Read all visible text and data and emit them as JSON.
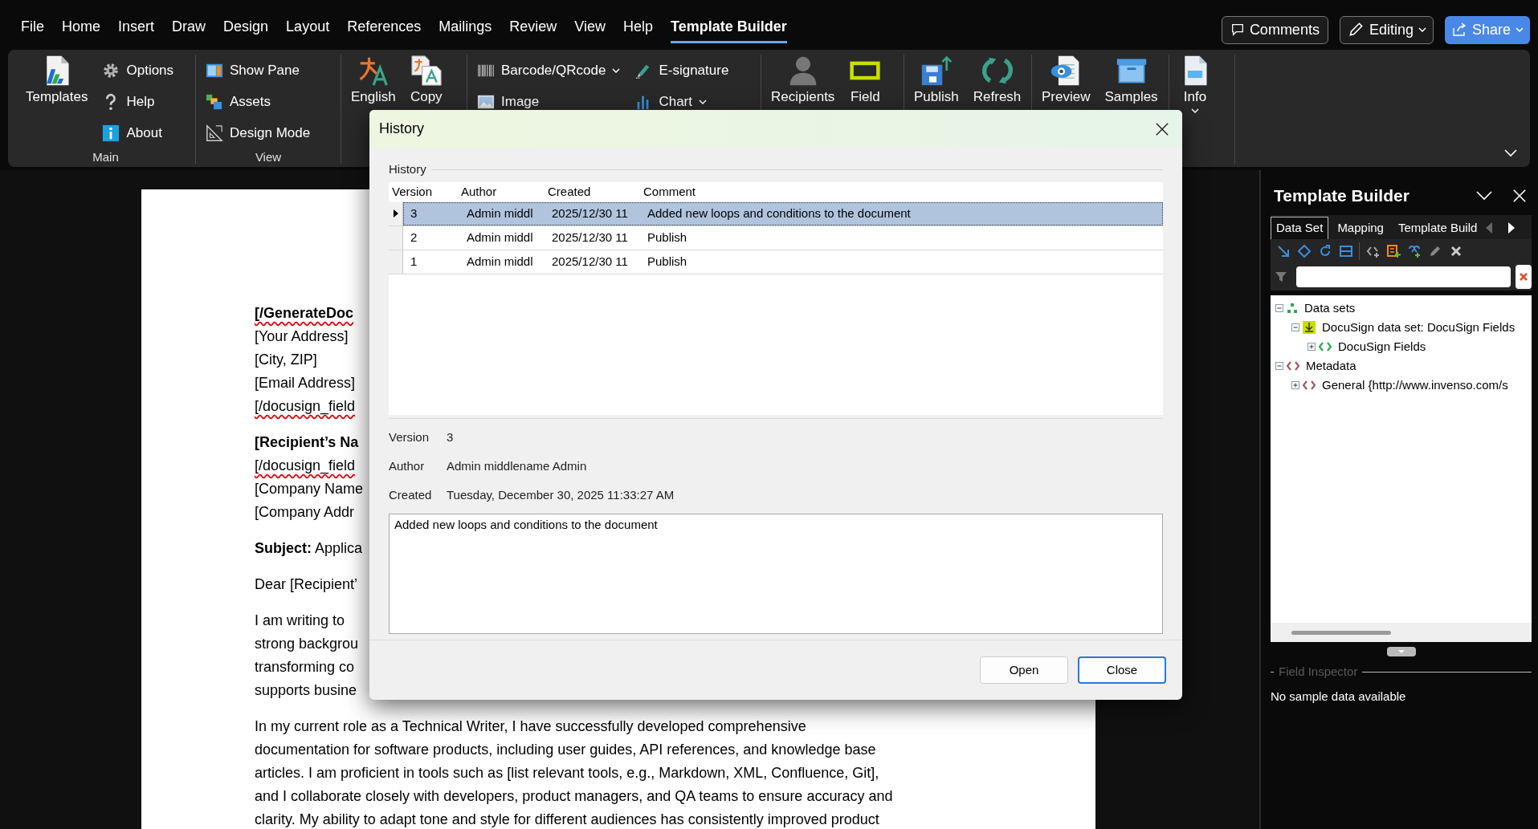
{
  "menu_tabs": [
    {
      "label": "File",
      "selected": false
    },
    {
      "label": "Home",
      "selected": false
    },
    {
      "label": "Insert",
      "selected": false
    },
    {
      "label": "Draw",
      "selected": false
    },
    {
      "label": "Design",
      "selected": false
    },
    {
      "label": "Layout",
      "selected": false
    },
    {
      "label": "References",
      "selected": false
    },
    {
      "label": "Mailings",
      "selected": false
    },
    {
      "label": "Review",
      "selected": false
    },
    {
      "label": "View",
      "selected": false
    },
    {
      "label": "Help",
      "selected": false
    },
    {
      "label": "Template Builder",
      "selected": true
    }
  ],
  "top_buttons": [
    {
      "kind": "comments",
      "label": "Comments"
    },
    {
      "kind": "editing",
      "label": "Editing"
    },
    {
      "kind": "share",
      "label": "Share"
    }
  ],
  "ribbon_groups": [
    {
      "label": "Main",
      "columns": [
        [
          {
            "kind": "large",
            "label": "Templates"
          }
        ],
        [
          {
            "kind": "small",
            "label": "Options"
          },
          {
            "kind": "small",
            "label": "Help"
          },
          {
            "kind": "small",
            "label": "About"
          }
        ]
      ]
    },
    {
      "label": "View",
      "columns": [
        [
          {
            "kind": "small",
            "label": "Show Pane"
          },
          {
            "kind": "small",
            "label": "Assets"
          },
          {
            "kind": "small",
            "label": "Design Mode"
          }
        ]
      ]
    },
    {
      "columns": [
        [
          {
            "kind": "large",
            "label": "English"
          }
        ],
        [
          {
            "kind": "large",
            "label": "Copy"
          }
        ]
      ]
    },
    {
      "columns": [
        [
          {
            "kind": "menu",
            "label": "Barcode/QRcode"
          },
          {
            "kind": "small",
            "label": "Image"
          }
        ],
        [
          {
            "kind": "small",
            "label": "E-signature"
          },
          {
            "kind": "menu",
            "label": "Chart"
          }
        ]
      ]
    },
    {
      "columns": [
        [
          {
            "kind": "large",
            "label": "Recipients"
          }
        ],
        [
          {
            "kind": "large",
            "label": "Field"
          }
        ]
      ]
    },
    {
      "columns": [
        [
          {
            "kind": "large",
            "label": "Publish"
          }
        ],
        [
          {
            "kind": "large",
            "label": "Refresh"
          }
        ]
      ]
    },
    {
      "columns": [
        [
          {
            "kind": "large",
            "label": "Preview"
          }
        ],
        [
          {
            "kind": "large",
            "label": "Samples"
          }
        ]
      ]
    },
    {
      "columns": [
        [
          {
            "kind": "large_menu",
            "label": "Info"
          }
        ]
      ]
    }
  ],
  "document": {
    "blocks": [
      {
        "lines": [
          {
            "text": "[/GenerateDoc",
            "bold": true,
            "misspelled": true
          },
          {
            "text": "[Your Address]",
            "bold": false,
            "misspelled": false
          },
          {
            "text": "[City, ZIP]",
            "bold": false,
            "misspelled": false
          },
          {
            "text": "[Email Address]",
            "bold": false,
            "misspelled": false
          },
          {
            "text": "[/docusign_field",
            "bold": false,
            "misspelled": true
          }
        ]
      },
      {
        "lines": [
          {
            "text": "[Recipient’s Na",
            "bold": true,
            "misspelled": false
          },
          {
            "text": "[/docusign_field",
            "bold": false,
            "misspelled": true
          },
          {
            "text": "[Company Name",
            "bold": false,
            "misspelled": false
          },
          {
            "text": "[Company Addr",
            "bold": false,
            "misspelled": false
          }
        ]
      },
      {
        "lines": [
          {
            "text": "**Subject:** Applica",
            "bold": false,
            "misspelled": false
          }
        ]
      },
      {
        "lines": [
          {
            "text": "Dear [Recipient’",
            "bold": false,
            "misspelled": false
          }
        ]
      },
      {
        "lines": [
          {
            "text": "I am writing to",
            "bold": false,
            "misspelled": false
          },
          {
            "text": "strong backgrou",
            "bold": false,
            "misspelled": false
          },
          {
            "text": "transforming co",
            "bold": false,
            "misspelled": false
          },
          {
            "text": "supports busine",
            "bold": false,
            "misspelled": false
          }
        ]
      },
      {
        "lines": [
          {
            "text": "In my current role as a Technical Writer, I have successfully developed comprehensive",
            "bold": false,
            "misspelled": false
          },
          {
            "text": "documentation for software products, including user guides, API references, and knowledge base",
            "bold": false,
            "misspelled": false
          },
          {
            "text": "articles. I am proficient in tools such as [list relevant tools, e.g., Markdown, XML, Confluence, Git],",
            "bold": false,
            "misspelled": false
          },
          {
            "text": "and I collaborate closely with developers, product managers, and QA teams to ensure accuracy and",
            "bold": false,
            "misspelled": false
          },
          {
            "text": "clarity. My ability to adapt tone and style for different audiences has consistently improved product",
            "bold": false,
            "misspelled": false
          }
        ]
      }
    ]
  },
  "history_dialog": {
    "title": "History",
    "group_label": "History",
    "columns": [
      "Version",
      "Author",
      "Created",
      "Comment"
    ],
    "rows": [
      {
        "cells": [
          "3",
          "Admin middl",
          "2025/12/30 11",
          "Added new loops and conditions to the document"
        ],
        "selected": true
      },
      {
        "cells": [
          "2",
          "Admin middl",
          "2025/12/30 11",
          "Publish"
        ],
        "selected": false
      },
      {
        "cells": [
          "1",
          "Admin middl",
          "2025/12/30 11",
          "Publish"
        ],
        "selected": false
      }
    ],
    "details": [
      {
        "label": "Version",
        "value": "3"
      },
      {
        "label": "Author",
        "value": "Admin middlename Admin"
      },
      {
        "label": "Created",
        "value": "Tuesday, December 30, 2025 11:33:27 AM"
      }
    ],
    "comment": "Added new loops and conditions to the document",
    "buttons": [
      {
        "label": "Open",
        "default": false
      },
      {
        "label": "Close",
        "default": true
      }
    ]
  },
  "side_pane": {
    "title": "Template Builder",
    "tabs": [
      {
        "label": "Data Set",
        "selected": true
      },
      {
        "label": "Mapping",
        "selected": false
      },
      {
        "label": "Template Build",
        "selected": false
      }
    ],
    "tree": [
      {
        "kind": "datasets",
        "label": "Data sets",
        "expanded": true,
        "children": [
          {
            "kind": "dataset",
            "label": "DocuSign data set: DocuSign Fields",
            "expanded": true,
            "children": [
              {
                "kind": "element",
                "label": "DocuSign Fields",
                "expanded": false
              }
            ]
          }
        ]
      },
      {
        "kind": "metadata",
        "label": "Metadata",
        "expanded": true,
        "children": [
          {
            "kind": "namespace",
            "label": "General {http://www.invenso.com/s",
            "expanded": false
          }
        ]
      }
    ],
    "inspector_label": "Field Inspector",
    "inspector_text": "No sample data available"
  }
}
